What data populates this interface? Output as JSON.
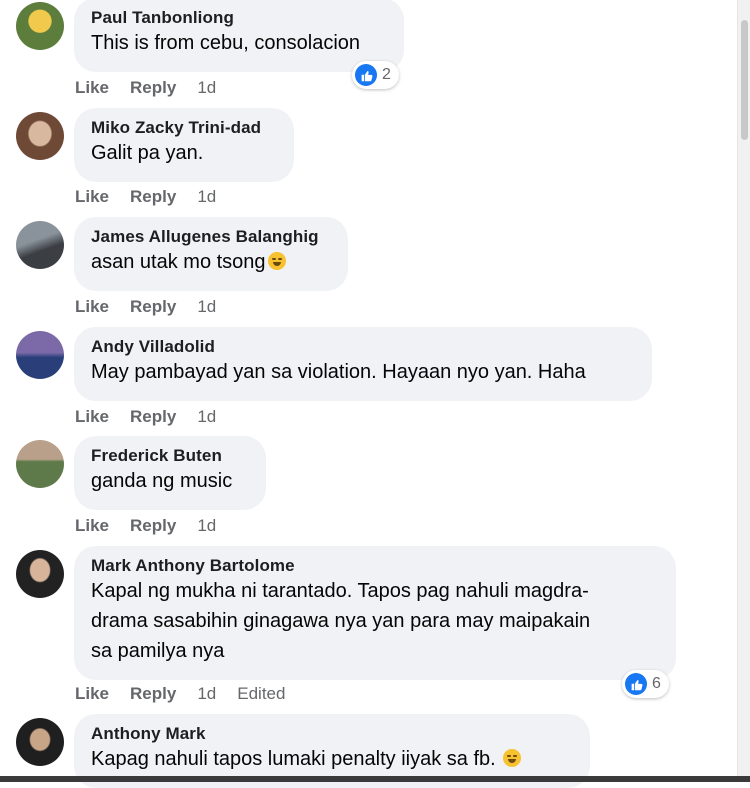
{
  "actions": {
    "like": "Like",
    "reply": "Reply"
  },
  "comments": [
    {
      "author": "Paul Tanbonliong",
      "lines": [
        "This is from cebu, consolacion"
      ],
      "time": "1d",
      "reactions": "2",
      "avatar_colors": [
        "#5c7d3b",
        "#f0c94d"
      ]
    },
    {
      "author": "Miko Zacky Trini-dad",
      "lines": [
        "Galit pa yan."
      ],
      "time": "1d",
      "avatar_colors": [
        "#6e4a36",
        "#d9b8a0"
      ]
    },
    {
      "author": "James Allugenes Balanghig",
      "lines": [
        "asan utak mo tsong"
      ],
      "time": "1d",
      "avatar_colors": [
        "#3b3f44",
        "#8a939b"
      ]
    },
    {
      "author": "Andy Villadolid",
      "lines": [
        "May pambayad yan sa violation. Hayaan nyo yan. Haha"
      ],
      "time": "1d",
      "avatar_colors": [
        "#2a3f7a",
        "#7c6aa8"
      ]
    },
    {
      "author": "Frederick Buten",
      "lines": [
        "ganda ng music"
      ],
      "time": "1d",
      "avatar_colors": [
        "#5f7a4a",
        "#b9a08a"
      ]
    },
    {
      "author": "Mark Anthony Bartolome",
      "lines": [
        "Kapal ng mukha ni tarantado. Tapos pag nahuli magdra-",
        "drama sasabihin ginagawa nya yan para may maipakain",
        "sa pamilya nya"
      ],
      "time": "1d",
      "edited": "Edited",
      "reactions": "6",
      "avatar_colors": [
        "#222222",
        "#d8b49a"
      ]
    },
    {
      "author": "Anthony Mark",
      "lines": [
        "Kapag nahuli tapos lumaki penalty iiyak sa fb."
      ],
      "avatar_colors": [
        "#1f1f1f",
        "#c9a587"
      ]
    }
  ],
  "icons": {
    "like_reaction": "thumbs-up-icon",
    "emoji_laugh": "laughing-emoji-icon",
    "emoji_smile": "smiling-emoji-icon"
  },
  "colors": {
    "bubble_bg": "#f0f2f5",
    "meta_text": "#65676b",
    "like_blue": "#1877f2"
  }
}
